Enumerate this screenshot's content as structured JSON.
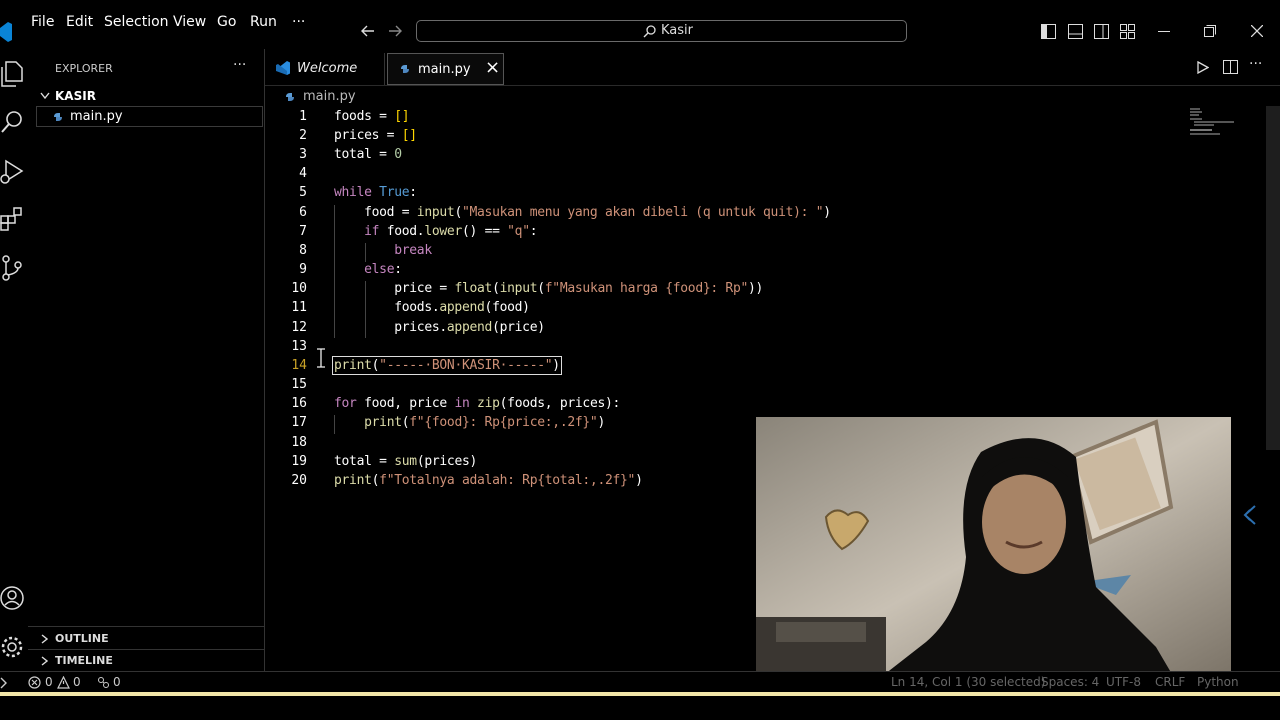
{
  "menu": [
    "File",
    "Edit",
    "Selection",
    "View",
    "Go",
    "Run",
    "···"
  ],
  "search": {
    "label": "Kasir"
  },
  "sidebar": {
    "title": "EXPLORER",
    "more": "···",
    "folder": "KASIR",
    "file": "main.py",
    "outline": "OUTLINE",
    "timeline": "TIMELINE"
  },
  "tabs": [
    {
      "label": "Welcome"
    },
    {
      "label": "main.py",
      "close": "×"
    }
  ],
  "breadcrumb": "main.py",
  "lines": [
    "1",
    "2",
    "3",
    "4",
    "5",
    "6",
    "7",
    "8",
    "9",
    "10",
    "11",
    "12",
    "13",
    "14",
    "15",
    "16",
    "17",
    "18",
    "19",
    "20"
  ],
  "code": {
    "l1": "foods = []",
    "l2": "prices = []",
    "l3": "total = 0",
    "l5": "while True:",
    "l6": "    food = input(\"Masukan menu yang akan dibeli (q untuk quit): \")",
    "l7": "    if food.lower() == \"q\":",
    "l8": "        break",
    "l9": "    else:",
    "l10": "        price = float(input(f\"Masukan harga {food}: Rp\"))",
    "l11": "        foods.append(food)",
    "l12": "        prices.append(price)",
    "l14": "print(\"-----·BON·KASIR·-----\")",
    "l16": "for food, price in zip(foods, prices):",
    "l17": "    print(f\"{food}: Rp{price:,.2f}\")",
    "l19": "total = sum(prices)",
    "l20": "print(f\"Totalnya adalah: Rp{total:,.2f}\")"
  },
  "status": {
    "errors": "0",
    "warnings": "0",
    "ports": "0",
    "position": "Ln 14, Col 1 (30 selected)",
    "spaces": "Spaces: 4",
    "encoding": "UTF-8",
    "eol": "CRLF",
    "language": "Python"
  },
  "colors": {
    "keyword": "#c586c0",
    "control": "#569cd6",
    "string": "#ce9178",
    "function": "#dcdcaa",
    "number": "#b5cea8",
    "bracket": "#ffd700"
  },
  "icons": [
    "vscode-icon",
    "explorer-icon",
    "search-icon",
    "run-debug-icon",
    "extensions-icon",
    "source-control-icon",
    "account-icon",
    "settings-icon",
    "run-icon",
    "split-editor-icon",
    "python-file-icon"
  ]
}
